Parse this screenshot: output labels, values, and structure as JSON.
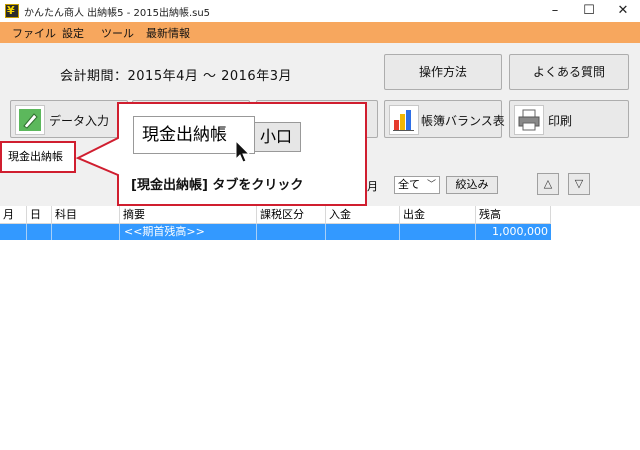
{
  "window": {
    "title": "かんたん商人 出納帳5 - 2015出納帳.su5",
    "min_glyph": "–",
    "max_glyph": "☐",
    "close_glyph": "✕"
  },
  "menu": [
    "ファイル",
    "設定",
    "ツール",
    "最新情報"
  ],
  "period_label": "会計期間：2015年4月 〜 2016年3月",
  "buttons": {
    "howto": "操作方法",
    "faq": "よくある質問",
    "data_entry": "データ入力",
    "balance": "帳簿バランス表",
    "print": "印刷"
  },
  "tab": {
    "label": "現金出納帳"
  },
  "callout": {
    "zoom_tab": "現金出納帳",
    "zoom_tab_partial": "小口",
    "instruction": "[現金出納帳] タブをクリック"
  },
  "filter": {
    "month_suffix": "月",
    "select_value": "全て",
    "narrow_label": "絞込み",
    "up_glyph": "△",
    "down_glyph": "▽"
  },
  "table": {
    "columns": [
      "月",
      "日",
      "科目",
      "摘要",
      "課税区分",
      "入金",
      "出金",
      "残高"
    ],
    "rows": [
      {
        "month": "",
        "day": "",
        "account": "",
        "summary": "<<期首残高>>",
        "tax": "",
        "deposit": "",
        "withdrawal": "",
        "balance": "1,000,000"
      }
    ]
  },
  "colors": {
    "menubar": "#f7a75e",
    "highlight": "#3399ff",
    "callout_border": "#d01e2f"
  }
}
